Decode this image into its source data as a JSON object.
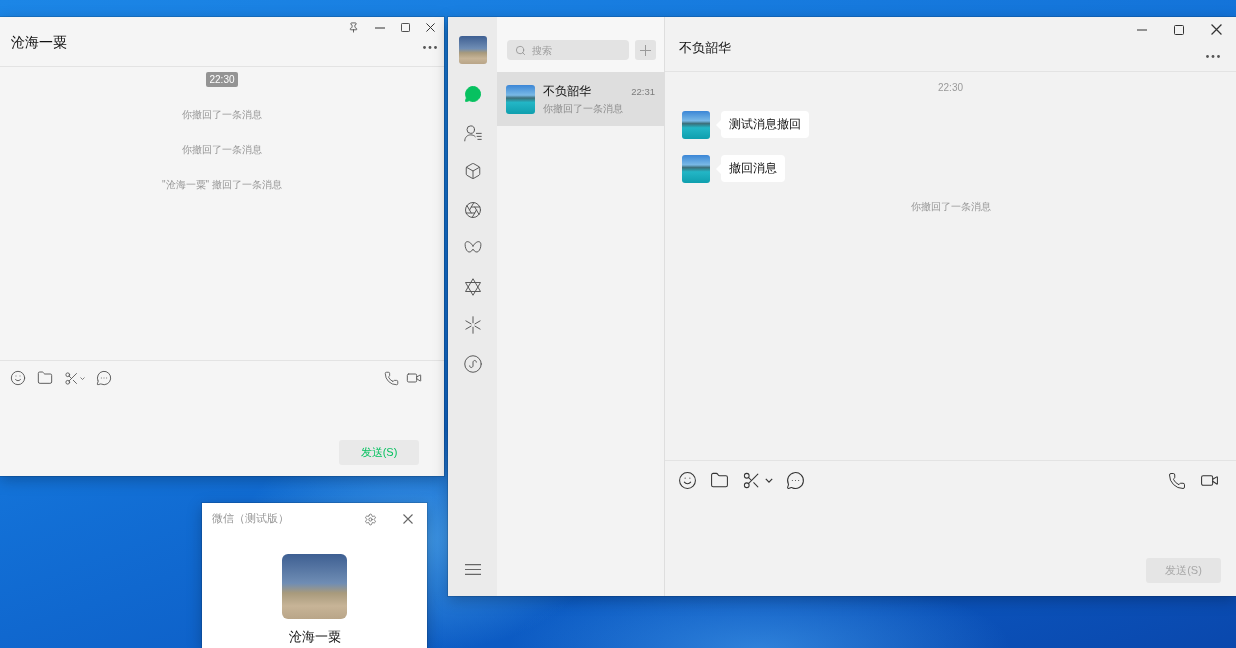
{
  "left_window": {
    "title": "沧海一粟",
    "messages": [
      {
        "kind": "time_badge",
        "text": "22:30"
      },
      {
        "kind": "notice",
        "text": "你撤回了一条消息"
      },
      {
        "kind": "notice",
        "text": "你撤回了一条消息"
      },
      {
        "kind": "notice",
        "text": "\"沧海一粟\" 撤回了一条消息"
      }
    ],
    "send_button": {
      "label": "发送(S)",
      "disabled": false
    }
  },
  "main_window": {
    "nav_items": [
      {
        "selected": true
      },
      {
        "selected": false
      },
      {
        "selected": false
      },
      {
        "selected": false
      },
      {
        "selected": false
      },
      {
        "selected": false
      },
      {
        "selected": false
      },
      {
        "selected": false
      }
    ],
    "search": {
      "placeholder": "搜索"
    },
    "chats": [
      {
        "name": "不负韶华",
        "time": "22:31",
        "preview": "你撤回了一条消息",
        "selected": true
      }
    ],
    "chat_title": "不负韶华",
    "messages": [
      {
        "kind": "time",
        "text": "22:30"
      },
      {
        "kind": "bubble",
        "text": "测试消息撤回"
      },
      {
        "kind": "bubble",
        "text": "撤回消息"
      },
      {
        "kind": "notice",
        "text": "你撤回了一条消息"
      }
    ],
    "send_button": {
      "label": "发送(S)",
      "disabled": true
    }
  },
  "login_popup": {
    "title": "微信（测试版）",
    "name": "沧海一粟"
  }
}
